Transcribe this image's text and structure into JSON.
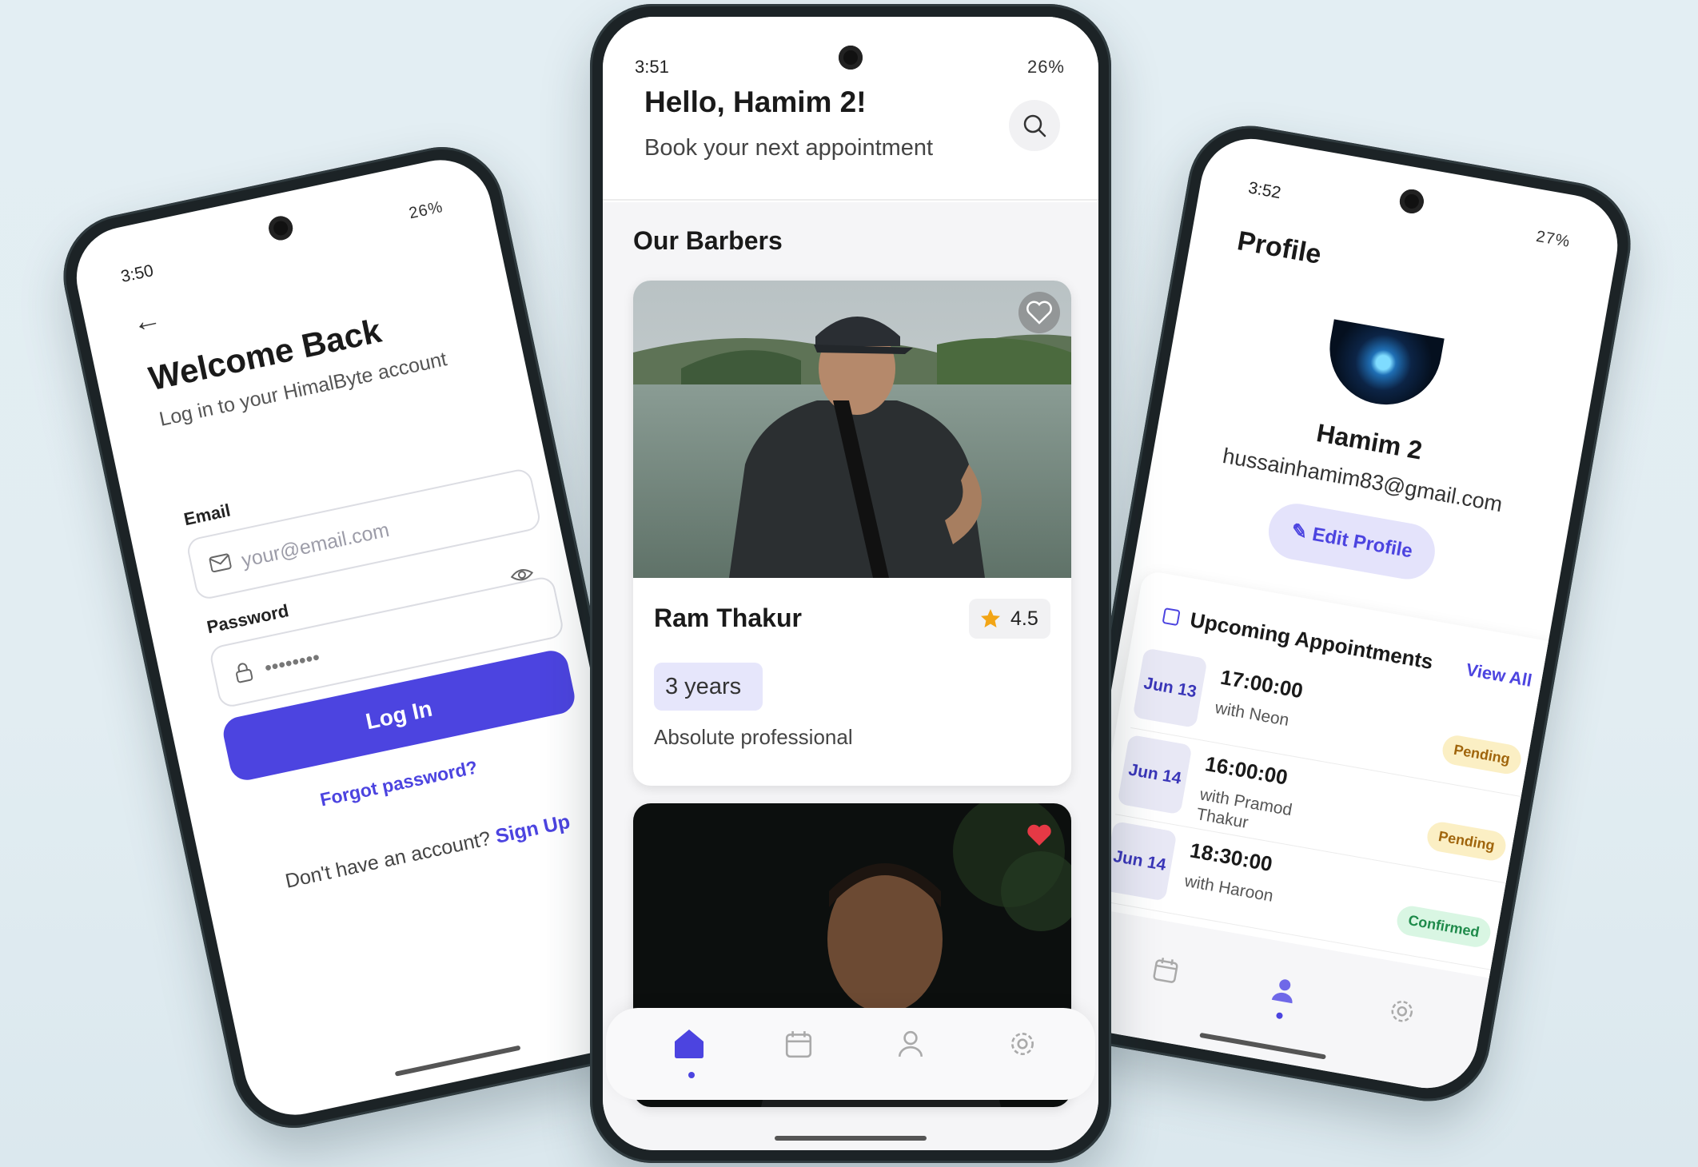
{
  "login_screen": {
    "status_time": "3:50",
    "status_right": "26%",
    "title": "Welcome Back",
    "subtitle": "Log in to your HimalByte account",
    "email_label": "Email",
    "email_placeholder": "your@email.com",
    "password_label": "Password",
    "password_value": "••••••••",
    "login_button": "Log In",
    "forgot_link": "Forgot password?",
    "signup_prompt": "Don't have an account?",
    "signup_link": "Sign Up"
  },
  "home_screen": {
    "status_time": "3:51",
    "status_right": "26%",
    "greeting": "Hello, Hamim 2!",
    "subtitle": "Book your next appointment",
    "section_title": "Our Barbers",
    "barbers": [
      {
        "name": "Ram Thakur",
        "rating": "4.5",
        "experience": "3  years",
        "description": "Absolute professional",
        "favorite": false
      },
      {
        "favorite": true
      }
    ],
    "nav": [
      "home-icon",
      "calendar-icon",
      "user-icon",
      "settings-icon"
    ],
    "active_nav": "home-icon"
  },
  "profile_screen": {
    "status_time": "3:52",
    "status_right": "27%",
    "title": "Profile",
    "name": "Hamim 2",
    "email": "hussainhamim83@gmail.com",
    "edit_button": "Edit Profile",
    "appointments_title": "Upcoming Appointments",
    "view_all": "View All",
    "appointments": [
      {
        "date": "Jun 13",
        "time": "17:00:00",
        "with": "with Neon",
        "status": "Pending"
      },
      {
        "date": "Jun 14",
        "time": "16:00:00",
        "with": "with Pramod Thakur",
        "status": "Pending"
      },
      {
        "date": "Jun 14",
        "time": "18:30:00",
        "with": "with Haroon",
        "status": "Confirmed"
      }
    ],
    "nav": [
      "calendar-icon",
      "user-icon",
      "settings-icon"
    ],
    "active_nav": "user-icon"
  },
  "colors": {
    "accent": "#4c44e0",
    "background": "#e2edf2",
    "pending": "#fbefc4",
    "confirmed": "#d9f6e3",
    "favorite": "#e53945"
  }
}
